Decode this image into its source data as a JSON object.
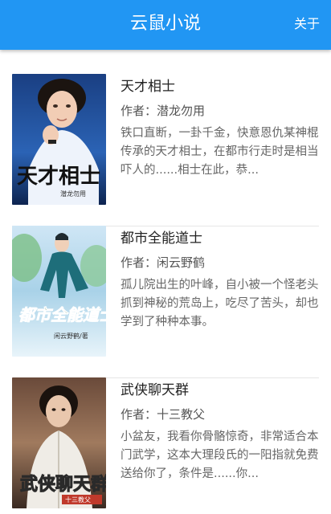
{
  "app_bar": {
    "title": "云鼠小说",
    "about_label": "关于",
    "color": "#2196f3"
  },
  "books": [
    {
      "title": "天才相士",
      "author": "作者：潜龙勿用",
      "description": "铁口直断，一卦千金，快意恩仇某神棍传承的天才相士，在都市行走时是相当吓人的......相士在此，恭...",
      "cover": {
        "title": "天才相士",
        "author": "潜龙勿用"
      }
    },
    {
      "title": "都市全能道士",
      "author": "作者：闲云野鹤",
      "description": "孤儿院出生的叶峰，自小被一个怪老头抓到神秘的荒岛上，吃尽了苦头，却也学到了种种本事。",
      "cover": {
        "title": "都市全能道士",
        "author": "闲云野鹤/著"
      }
    },
    {
      "title": "武侠聊天群",
      "author": "作者：十三教父",
      "description": "小盆友，我看你骨骼惊奇，非常适合本门武学，这本大理段氏的一阳指就免费送给你了，条件是......你...",
      "cover": {
        "title": "武侠聊天群",
        "author": "十三教父"
      }
    }
  ]
}
